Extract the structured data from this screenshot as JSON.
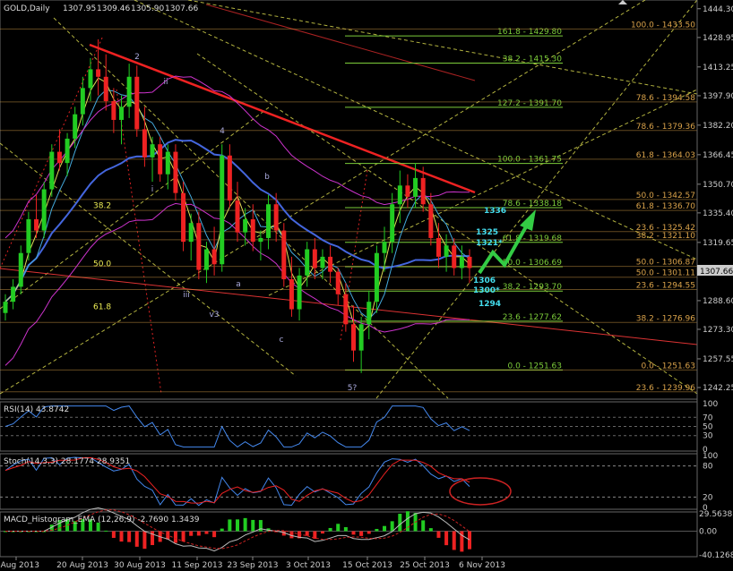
{
  "header": {
    "symbol_label": "GOLD,Daily",
    "ohlc": [
      "1307.95",
      "1309.46",
      "1305.90",
      "1307.66"
    ]
  },
  "price_axis": {
    "ticks": [
      "1444.30",
      "1428.95",
      "1413.25",
      "1397.90",
      "1382.20",
      "1366.45",
      "1350.70",
      "1335.40",
      "1319.65",
      "1304.55",
      "1288.60",
      "1273.30",
      "1257.55",
      "1242.25"
    ],
    "current_price": "1307.66"
  },
  "time_axis": {
    "labels": [
      "8 Aug 2013",
      "20 Aug 2013",
      "30 Aug 2013",
      "11 Sep 2013",
      "23 Sep 2013",
      "3 Oct 2013",
      "15 Oct 2013",
      "25 Oct 2013",
      "6 Nov 2013"
    ]
  },
  "fib_levels": {
    "green": [
      {
        "label": "161.8 - 1429.80",
        "price": 1429.8
      },
      {
        "label": "38.2 - 1415.30",
        "price": 1415.3
      },
      {
        "label": "127.2 - 1391.70",
        "price": 1391.7
      },
      {
        "label": "100.0 - 1361.75",
        "price": 1361.75
      },
      {
        "label": "78.6 - 1338.18",
        "price": 1338.18
      },
      {
        "label": "61.8 - 1319.68",
        "price": 1319.68
      },
      {
        "label": "50.0 - 1306.69",
        "price": 1306.69
      },
      {
        "label": "38.2 - 1293.70",
        "price": 1293.7
      },
      {
        "label": "23.6 - 1277.62",
        "price": 1277.62
      },
      {
        "label": "0.0 - 1251.63",
        "price": 1251.63
      }
    ],
    "orange_right": [
      {
        "label": "100.0 - 1433.50",
        "price": 1433.5
      },
      {
        "label": "78.6 - 1394.58",
        "price": 1394.58
      },
      {
        "label": "78.6 - 1379.36",
        "price": 1379.36
      },
      {
        "label": "61.8 - 1364.03",
        "price": 1364.03
      },
      {
        "label": "50.0 - 1342.57",
        "price": 1342.57
      },
      {
        "label": "61.8 - 1336.70",
        "price": 1336.7
      },
      {
        "label": "23.6 - 1325.42",
        "price": 1325.42
      },
      {
        "label": "38.2 - 1321.10",
        "price": 1321.1
      },
      {
        "label": "50.0 - 1306.87",
        "price": 1306.87
      },
      {
        "label": "50.0 - 1301.11",
        "price": 1301.11
      },
      {
        "label": "23.6 - 1294.55",
        "price": 1294.55
      },
      {
        "label": "38.2 - 1276.96",
        "price": 1276.96
      },
      {
        "label": "0.0 - 1251.63",
        "price": 1251.63
      },
      {
        "label": "23.6 - 1239.96",
        "price": 1239.96
      }
    ],
    "left_labels": [
      "38.2",
      "50.0",
      "61.8"
    ]
  },
  "wave_labels": [
    "2",
    "ii",
    "i",
    "iii",
    "v3",
    "4",
    "b",
    "a",
    "c",
    "5?"
  ],
  "target_labels": [
    "1336",
    "1325",
    "1321*",
    "1306",
    "1300*",
    "1294"
  ],
  "rsi": {
    "label": "RSI(14) 43.8742",
    "ticks": [
      "100",
      "70",
      "50",
      "30",
      "0"
    ]
  },
  "stoch": {
    "label": "Stoch(14,3,3) 28.1774 28.9351",
    "ticks": [
      "100",
      "80",
      "20",
      "0"
    ]
  },
  "macd": {
    "label": "MACD_Histogram_EMA (12,26,9) -2.7690 1.3439",
    "ticks": [
      "29.5638",
      "0.00",
      "-40.1268"
    ]
  },
  "colors": {
    "background": "#000000",
    "bull": "#22cc22",
    "bear": "#ee2222",
    "fib_green": "#7ccd3a",
    "fib_orange": "#d9a24a",
    "ma_blue": "#4466dd",
    "bollinger": "#cc33cc",
    "trend_red": "#ee2222",
    "channel_yellow": "#eeee55",
    "target_cyan": "#44ddee"
  },
  "chart_data": {
    "type": "candlestick",
    "title": "GOLD,Daily",
    "ylim": [
      1237,
      1448
    ],
    "x_labels": [
      "8 Aug 2013",
      "20 Aug 2013",
      "30 Aug 2013",
      "11 Sep 2013",
      "23 Sep 2013",
      "3 Oct 2013",
      "15 Oct 2013",
      "25 Oct 2013",
      "6 Nov 2013"
    ],
    "candles": [
      [
        1282,
        1292,
        1278,
        1288
      ],
      [
        1288,
        1300,
        1284,
        1296
      ],
      [
        1296,
        1318,
        1292,
        1314
      ],
      [
        1314,
        1336,
        1310,
        1332
      ],
      [
        1332,
        1345,
        1322,
        1326
      ],
      [
        1326,
        1352,
        1322,
        1348
      ],
      [
        1348,
        1372,
        1344,
        1368
      ],
      [
        1368,
        1380,
        1358,
        1362
      ],
      [
        1362,
        1378,
        1355,
        1375
      ],
      [
        1375,
        1392,
        1370,
        1388
      ],
      [
        1388,
        1408,
        1382,
        1402
      ],
      [
        1402,
        1418,
        1395,
        1412
      ],
      [
        1412,
        1428,
        1398,
        1408
      ],
      [
        1408,
        1420,
        1390,
        1395
      ],
      [
        1395,
        1402,
        1378,
        1385
      ],
      [
        1385,
        1398,
        1372,
        1392
      ],
      [
        1392,
        1415,
        1386,
        1408
      ],
      [
        1408,
        1414,
        1376,
        1380
      ],
      [
        1380,
        1392,
        1360,
        1365
      ],
      [
        1365,
        1376,
        1352,
        1372
      ],
      [
        1372,
        1376,
        1352,
        1356
      ],
      [
        1356,
        1372,
        1348,
        1368
      ],
      [
        1368,
        1372,
        1342,
        1346
      ],
      [
        1346,
        1352,
        1315,
        1320
      ],
      [
        1320,
        1335,
        1310,
        1330
      ],
      [
        1330,
        1336,
        1300,
        1305
      ],
      [
        1305,
        1320,
        1298,
        1316
      ],
      [
        1316,
        1328,
        1302,
        1308
      ],
      [
        1308,
        1372,
        1304,
        1366
      ],
      [
        1366,
        1372,
        1338,
        1342
      ],
      [
        1342,
        1352,
        1320,
        1325
      ],
      [
        1325,
        1338,
        1318,
        1332
      ],
      [
        1332,
        1340,
        1315,
        1320
      ],
      [
        1320,
        1326,
        1310,
        1322
      ],
      [
        1322,
        1345,
        1316,
        1340
      ],
      [
        1340,
        1346,
        1320,
        1326
      ],
      [
        1326,
        1330,
        1296,
        1300
      ],
      [
        1300,
        1312,
        1280,
        1284
      ],
      [
        1284,
        1306,
        1278,
        1302
      ],
      [
        1302,
        1320,
        1296,
        1316
      ],
      [
        1316,
        1322,
        1300,
        1306
      ],
      [
        1306,
        1316,
        1300,
        1312
      ],
      [
        1312,
        1318,
        1298,
        1304
      ],
      [
        1304,
        1306,
        1286,
        1292
      ],
      [
        1292,
        1298,
        1272,
        1276
      ],
      [
        1276,
        1286,
        1256,
        1262
      ],
      [
        1262,
        1280,
        1250,
        1276
      ],
      [
        1276,
        1294,
        1268,
        1288
      ],
      [
        1288,
        1318,
        1282,
        1314
      ],
      [
        1314,
        1328,
        1304,
        1320
      ],
      [
        1320,
        1346,
        1314,
        1340
      ],
      [
        1340,
        1358,
        1330,
        1350
      ],
      [
        1350,
        1356,
        1338,
        1344
      ],
      [
        1344,
        1362,
        1338,
        1354
      ],
      [
        1354,
        1360,
        1336,
        1340
      ],
      [
        1340,
        1346,
        1318,
        1322
      ],
      [
        1322,
        1330,
        1306,
        1312
      ],
      [
        1312,
        1324,
        1304,
        1318
      ],
      [
        1318,
        1322,
        1302,
        1306
      ],
      [
        1306,
        1318,
        1300,
        1312
      ],
      [
        1312,
        1316,
        1298,
        1306
      ]
    ]
  }
}
